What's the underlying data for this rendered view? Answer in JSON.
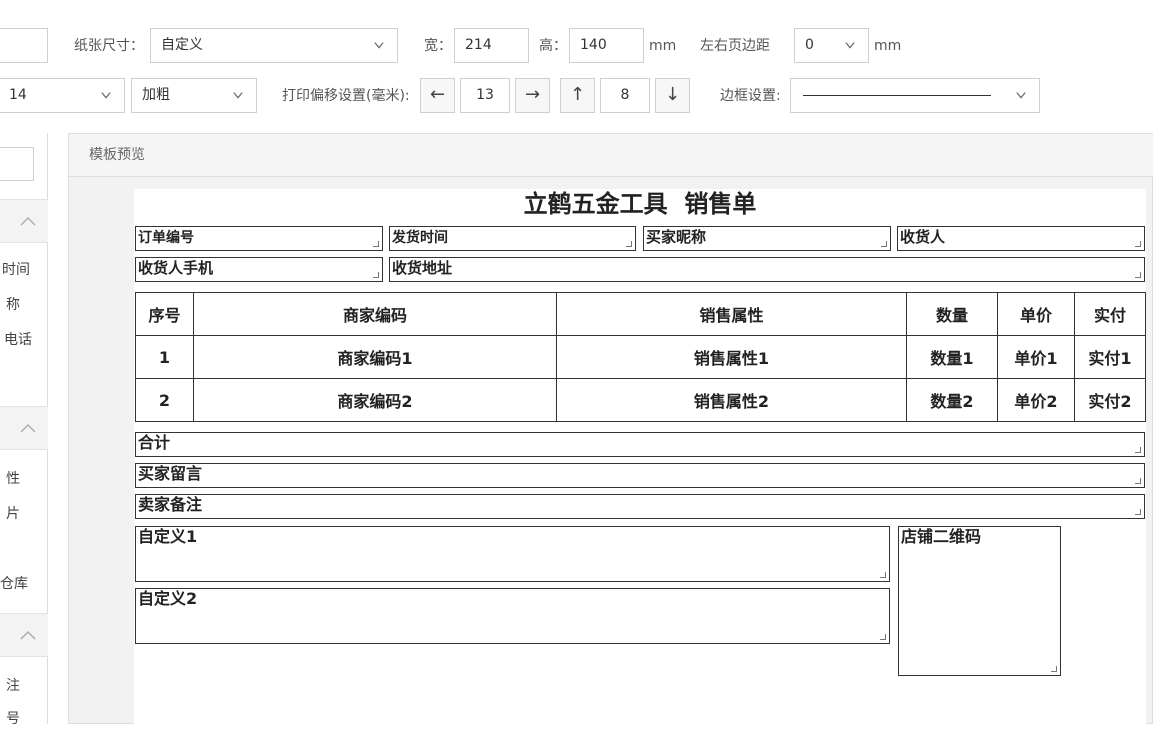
{
  "toolbar": {
    "paper_size_label": "纸张尺寸：",
    "paper_size_value": "自定义",
    "width_label": "宽：",
    "width_value": "214",
    "height_label": "高：",
    "height_value": "140",
    "mm1": "mm",
    "margin_label": "左右页边距",
    "margin_value": "0",
    "mm2": "mm",
    "font_size_value": "14",
    "font_weight_value": "加粗",
    "offset_label": "打印偏移设置(毫米):",
    "left_arrow": "←",
    "offset_x": "13",
    "right_arrow": "→",
    "up_arrow": "↑",
    "offset_y": "8",
    "down_arrow": "↓",
    "border_label": "边框设置:"
  },
  "sidebar": {
    "group1_items": [
      "时间",
      "称",
      "电话"
    ],
    "group2_items": [
      "性",
      "片",
      "仓库"
    ],
    "group3_items": [
      "注",
      "号"
    ]
  },
  "preview": {
    "title": "模板预览",
    "doc_title": "立鹤五金工具  销售单",
    "row1": [
      "订单编号",
      "发货时间",
      "买家昵称",
      "收货人"
    ],
    "row2": [
      "收货人手机",
      "收货地址"
    ],
    "table": {
      "headers": [
        "序号",
        "商家编码",
        "销售属性",
        "数量",
        "单价",
        "实付"
      ],
      "rows": [
        [
          "1",
          "商家编码1",
          "销售属性1",
          "数量1",
          "单价1",
          "实付1"
        ],
        [
          "2",
          "商家编码2",
          "销售属性2",
          "数量2",
          "单价2",
          "实付2"
        ]
      ]
    },
    "total": "合计",
    "buyer_message": "买家留言",
    "seller_note": "卖家备注",
    "custom1": "自定义1",
    "custom2": "自定义2",
    "qrcode": "店铺二维码"
  }
}
